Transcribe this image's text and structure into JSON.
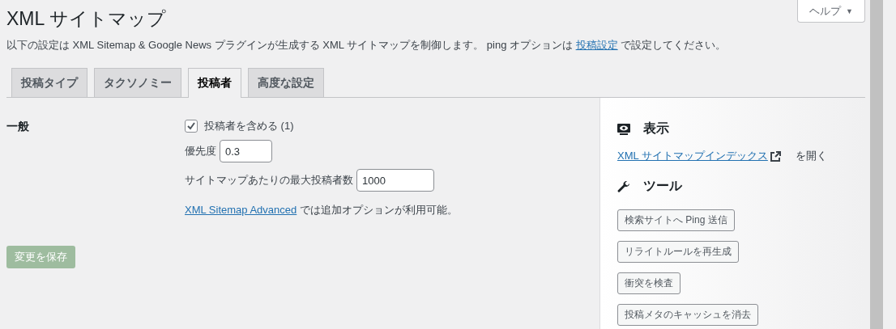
{
  "help_button": {
    "label": "ヘルプ",
    "caret": "▼"
  },
  "title": "XML サイトマップ",
  "description": {
    "before": "以下の設定は XML Sitemap & Google News プラグインが生成する XML サイトマップを制御します。 ping オプションは",
    "link": "投稿設定",
    "after": "で設定してください。"
  },
  "tabs": [
    {
      "label": "投稿タイプ",
      "selected": false
    },
    {
      "label": "タクソノミー",
      "selected": false
    },
    {
      "label": "投稿者",
      "selected": true
    },
    {
      "label": "高度な設定",
      "selected": false
    }
  ],
  "section": {
    "heading": "一般",
    "include": {
      "label": "投稿者を含める (1)",
      "checked": true
    },
    "priority": {
      "label": "優先度",
      "value": "0.3"
    },
    "max_authors": {
      "label": "サイトマップあたりの最大投稿者数",
      "value": "1000"
    },
    "advanced_note": {
      "link": "XML Sitemap Advanced",
      "after": "では追加オプションが利用可能。"
    }
  },
  "save_button": {
    "label": "変更を保存",
    "disabled": true
  },
  "sidebar": {
    "view_heading": "表示",
    "index_link": "XML サイトマップインデックス",
    "index_after": "を開く",
    "tools_heading": "ツール",
    "tools": [
      "検索サイトへ Ping 送信",
      "リライトルールを再生成",
      "衝突を検査",
      "投稿メタのキャッシュを消去"
    ]
  }
}
